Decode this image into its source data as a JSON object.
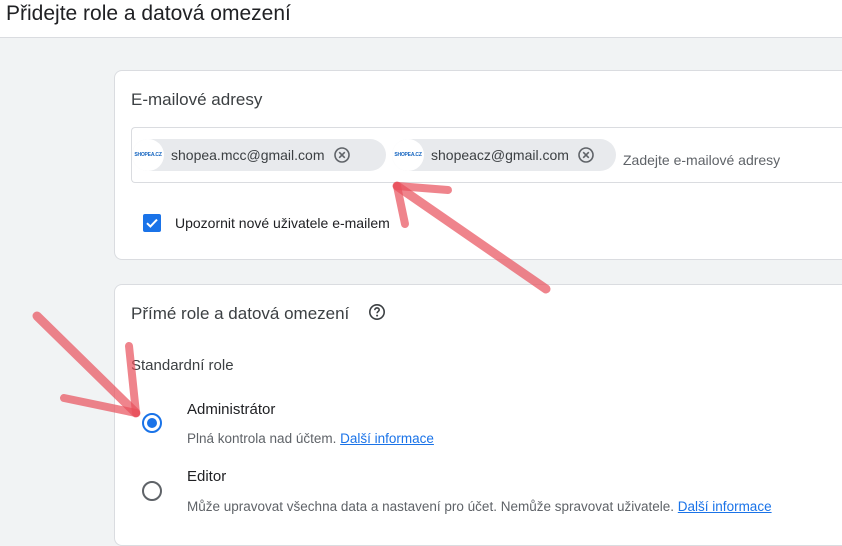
{
  "page": {
    "title": "Přidejte role a datová omezení"
  },
  "email_section": {
    "title": "E-mailové adresy",
    "chips": [
      {
        "avatar_text": "SHOPEA.CZ",
        "email": "shopea.mcc@gmail.com"
      },
      {
        "avatar_text": "SHOPEA.CZ",
        "email": "shopeacz@gmail.com"
      }
    ],
    "placeholder": "Zadejte e-mailové adresy",
    "notify_checkbox": {
      "label": "Upozornit nové uživatele e-mailem",
      "checked": true
    }
  },
  "roles_section": {
    "title": "Přímé role a datová omezení",
    "standard_label": "Standardní role",
    "roles": [
      {
        "name": "Administrátor",
        "description": "Plná kontrola nad účtem.",
        "link": "Další informace",
        "selected": true
      },
      {
        "name": "Editor",
        "description": "Může upravovat všechna data a nastavení pro účet. Nemůže spravovat uživatele.",
        "link": "Další informace",
        "selected": false
      }
    ]
  },
  "colors": {
    "accent": "#1a73e8",
    "annotation": "#e8505b"
  }
}
